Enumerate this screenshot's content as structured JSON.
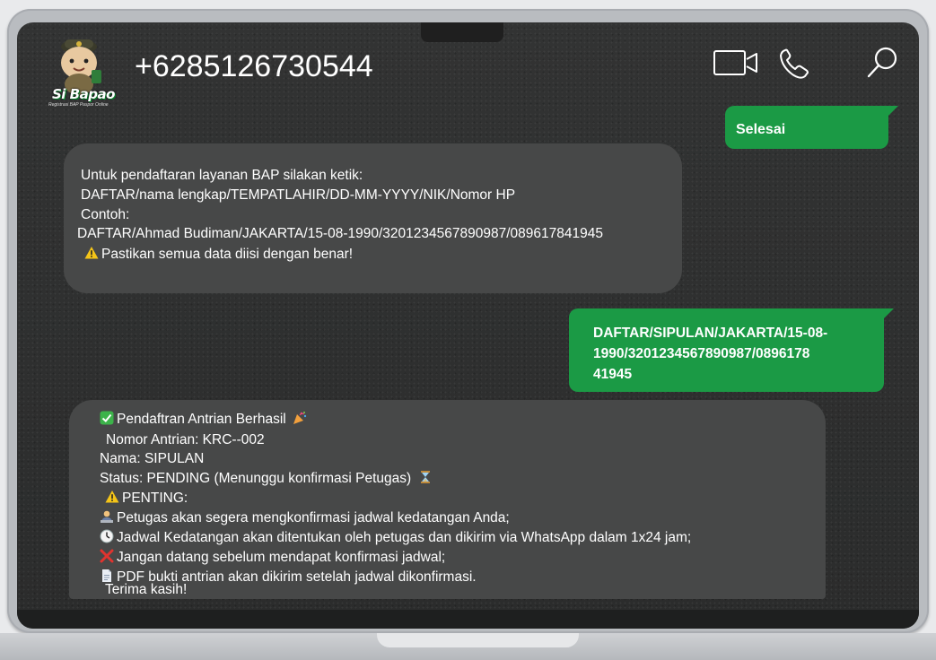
{
  "contact": {
    "brand_name": "Si Bapao",
    "brand_tagline": "Registrasi BAP Paspor Online",
    "phone": "+6285126730544"
  },
  "header_icons": [
    "video-call-icon",
    "voice-call-icon",
    "search-icon"
  ],
  "messages": [
    {
      "direction": "outgoing",
      "lines": [
        "Selesai"
      ]
    },
    {
      "direction": "incoming",
      "lines": [
        "Untuk pendaftaran layanan BAP silakan ketik:",
        "DAFTAR/nama lengkap/TEMPATLAHIR/DD-MM-YYYY/NIK/Nomor HP",
        "Contoh:",
        "DAFTAR/Ahmad Budiman/JAKARTA/15-08-1990/3201234567890987/089617841945",
        "Pastikan semua data diisi dengan benar!"
      ]
    },
    {
      "direction": "outgoing",
      "lines": [
        "DAFTAR/SIPULAN/JAKARTA/15-08-",
        "1990/3201234567890987/0896178",
        "41945"
      ]
    },
    {
      "direction": "incoming",
      "lines": [
        "Pendaftran Antrian Berhasil",
        "Nomor Antrian: KRC--002",
        "Nama: SIPULAN",
        "Status: PENDING (Menunggu konfirmasi Petugas)",
        "PENTING:",
        "Petugas akan segera mengkonfirmasi jadwal kedatangan Anda;",
        "Jadwal Kedatangan akan ditentukan oleh petugas dan dikirim via WhatsApp dalam 1x24 jam;",
        "Jangan datang sebelum mendapat konfirmasi jadwal;",
        "PDF bukti antrian akan dikirim setelah jadwal dikonfirmasi.",
        "Terima kasih!"
      ]
    }
  ],
  "colors": {
    "screen_background": "#2f3030",
    "incoming_bubble": "#474848",
    "outgoing_bubble": "#1b9a45",
    "text": "#ffffff"
  }
}
